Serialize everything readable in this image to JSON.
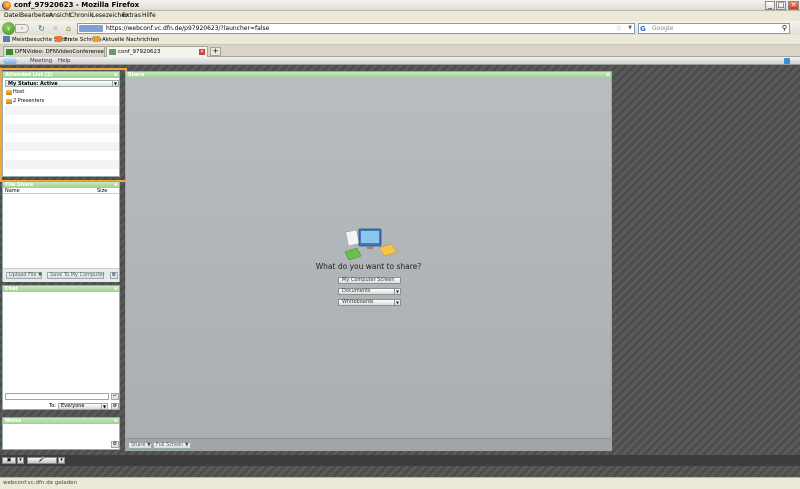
{
  "window": {
    "title": "conf_97920623 - Mozilla Firefox"
  },
  "menubar": {
    "items": [
      "Datei",
      "Bearbeiten",
      "Ansicht",
      "Chronik",
      "Lesezeichen",
      "Extras",
      "Hilfe"
    ]
  },
  "navbar": {
    "url": "https://webconf.vc.dfn.de/p97920623/?launcher=false",
    "search_placeholder": "Google"
  },
  "bookmarks": {
    "items": [
      "Meistbesuchte Seiten",
      "Erste Schritte",
      "Aktuelle Nachrichten"
    ]
  },
  "tabs": [
    {
      "label": "DFNVideo: DFNVideoConference",
      "active": false
    },
    {
      "label": "conf_97920623",
      "active": true
    }
  ],
  "app": {
    "menu": [
      "Meeting",
      "Help"
    ],
    "attendees": {
      "header": "Attendee List (2)",
      "status_label": "My Status: Active",
      "categories": [
        "Host",
        "2 Presenters"
      ]
    },
    "files": {
      "header": "File Share",
      "col_name": "Name",
      "col_size": "Size",
      "upload_label": "Upload File",
      "save_label": "Save To My Computer"
    },
    "chat": {
      "header": "Chat",
      "to_label": "To:",
      "to_value": "Everyone"
    },
    "notes": {
      "header": "Notes"
    },
    "share": {
      "header": "Share",
      "question": "What do you want to share?",
      "options": [
        "My Computer Screen",
        "Documents",
        "Whiteboards"
      ],
      "stop_label": "Share",
      "fullscreen_label": "Full Screen"
    }
  },
  "statusbar": {
    "text": "webconf.vc.dfn.de geladen"
  },
  "colors": {
    "pod_header": "#9fd08f",
    "highlight": "#f2a53a",
    "app_background": "#555555"
  }
}
